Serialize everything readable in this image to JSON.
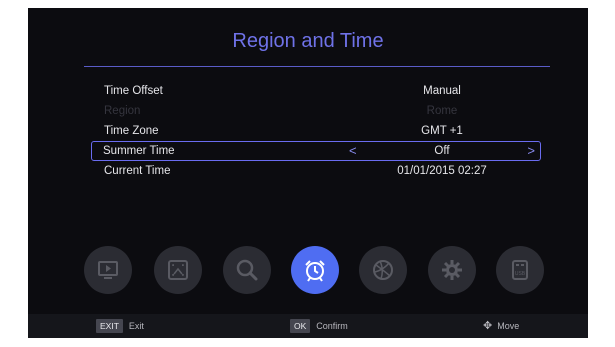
{
  "header": {
    "title": "Region and Time"
  },
  "menu": {
    "rows": [
      {
        "label": "Time Offset",
        "value": "Manual"
      },
      {
        "label": "Region",
        "value": "Rome"
      },
      {
        "label": "Time Zone",
        "value": "GMT +1"
      },
      {
        "label": "Summer Time",
        "value": "Off",
        "left_arrow": "<",
        "right_arrow": ">"
      },
      {
        "label": "Current Time",
        "value": "01/01/2015 02:27"
      }
    ]
  },
  "dock": {
    "icons": [
      "tv-icon",
      "picture-icon",
      "search-icon",
      "alarm-clock-icon",
      "globe-icon",
      "settings-icon",
      "usb-icon"
    ],
    "active": "alarm-clock-icon",
    "accent": "#4f6df2"
  },
  "footer": {
    "exit_key": "EXIT",
    "exit_label": "Exit",
    "ok_key": "OK",
    "ok_label": "Confirm",
    "move_label": "Move"
  }
}
